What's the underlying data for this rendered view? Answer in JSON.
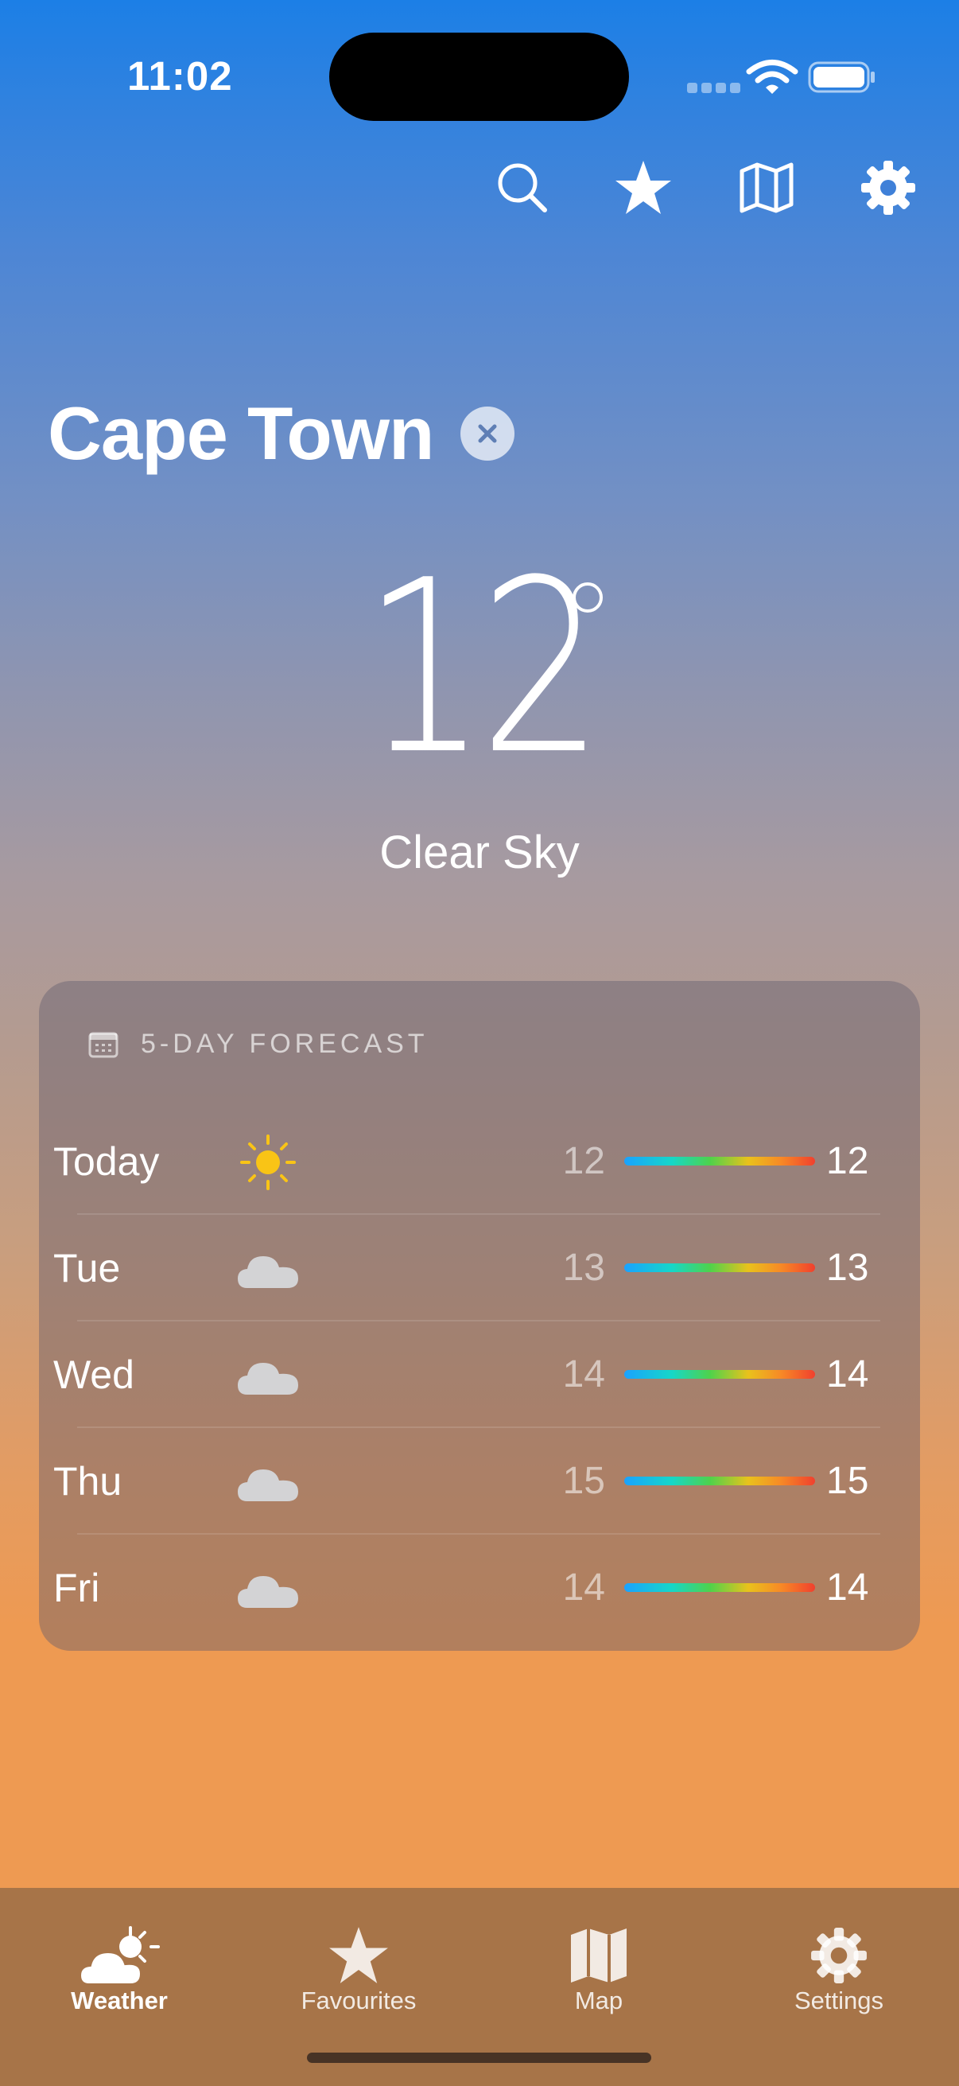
{
  "status_bar": {
    "time": "11:02"
  },
  "top_actions": [
    {
      "name": "search",
      "icon": "search-icon"
    },
    {
      "name": "favourite",
      "icon": "star-icon"
    },
    {
      "name": "map",
      "icon": "map-icon"
    },
    {
      "name": "settings",
      "icon": "gear-icon"
    }
  ],
  "location": {
    "city": "Cape Town",
    "clear_icon": "close-icon"
  },
  "current": {
    "temperature": "12",
    "condition": "Clear Sky"
  },
  "forecast": {
    "title": "5-DAY FORECAST",
    "icon": "calendar-icon",
    "days": [
      {
        "day": "Today",
        "icon": "sun-icon",
        "low": "12",
        "high": "12"
      },
      {
        "day": "Tue",
        "icon": "cloud-icon",
        "low": "13",
        "high": "13"
      },
      {
        "day": "Wed",
        "icon": "cloud-icon",
        "low": "14",
        "high": "14"
      },
      {
        "day": "Thu",
        "icon": "cloud-icon",
        "low": "15",
        "high": "15"
      },
      {
        "day": "Fri",
        "icon": "cloud-icon",
        "low": "14",
        "high": "14"
      }
    ]
  },
  "tabs": [
    {
      "label": "Weather",
      "icon": "cloud-sun-icon",
      "active": true
    },
    {
      "label": "Favourites",
      "icon": "star-icon",
      "active": false
    },
    {
      "label": "Map",
      "icon": "map-icon",
      "active": false
    },
    {
      "label": "Settings",
      "icon": "gear-icon",
      "active": false
    }
  ],
  "colors": {
    "sun": "#f9c416",
    "cloud": "#d3d3d5",
    "tab_bar": "#a77448"
  }
}
